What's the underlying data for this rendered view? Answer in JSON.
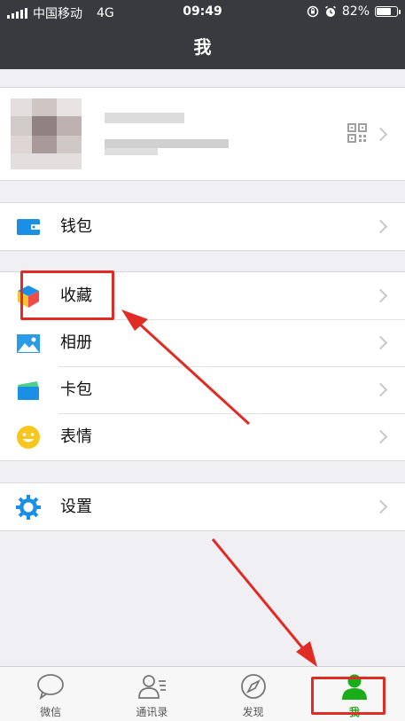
{
  "status_bar": {
    "carrier": "中国移动",
    "network": "4G",
    "time": "09:49",
    "battery": "82%",
    "battery_level": 0.82
  },
  "header": {
    "title": "我"
  },
  "menu": {
    "wallet": {
      "label": "钱包"
    },
    "items": [
      {
        "label": "收藏",
        "icon": "favorites-cube-icon"
      },
      {
        "label": "相册",
        "icon": "album-icon"
      },
      {
        "label": "卡包",
        "icon": "card-wallet-icon"
      },
      {
        "label": "表情",
        "icon": "smiley-icon"
      }
    ],
    "settings": {
      "label": "设置"
    }
  },
  "tab_bar": {
    "tabs": [
      {
        "label": "微信",
        "icon": "chat-bubble-icon"
      },
      {
        "label": "通讯录",
        "icon": "contacts-icon"
      },
      {
        "label": "发现",
        "icon": "compass-icon"
      },
      {
        "label": "我",
        "icon": "person-icon",
        "active": true
      }
    ]
  },
  "colors": {
    "header_bg": "#383a3f",
    "accent_green": "#1aad19",
    "annotation_red": "#e12b25",
    "icon_blue": "#1a8fe5"
  }
}
